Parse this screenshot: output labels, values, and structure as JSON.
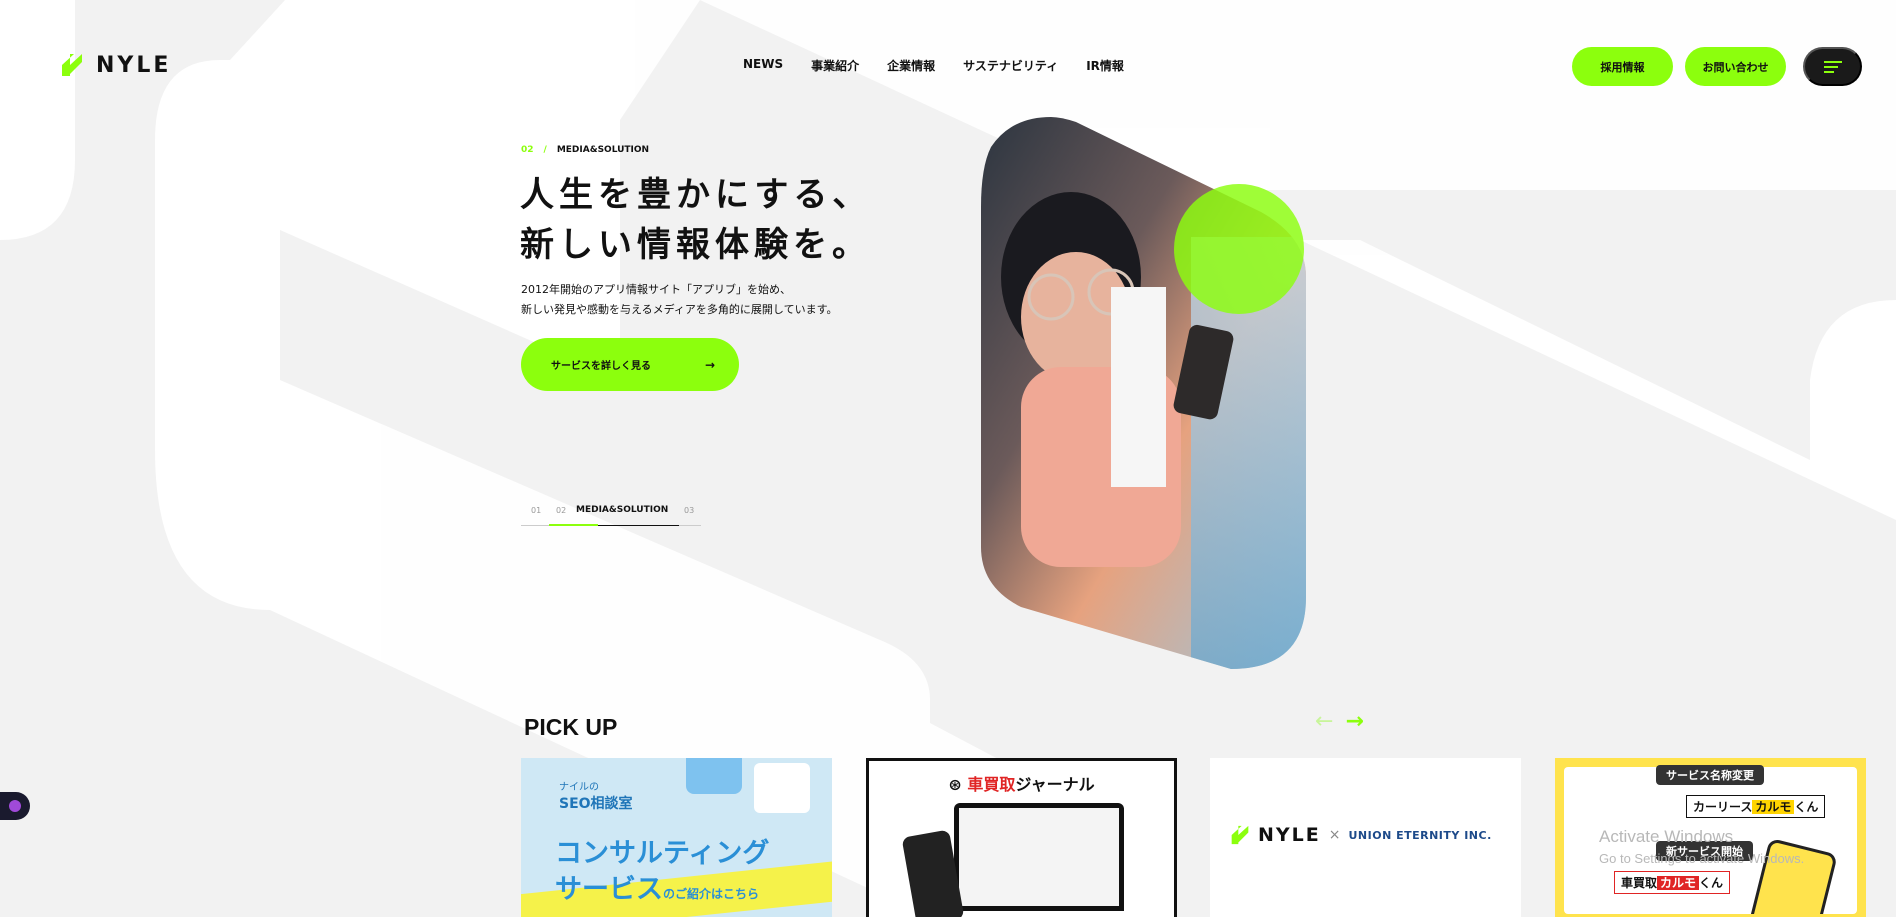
{
  "brand": {
    "logo_text": "NYLE",
    "accent": "#8cff0d"
  },
  "nav": {
    "items": [
      {
        "label": "NEWS"
      },
      {
        "label": "事業紹介"
      },
      {
        "label": "企業情報"
      },
      {
        "label": "サステナビリティ"
      },
      {
        "label": "IR情報"
      }
    ]
  },
  "header": {
    "recruit_label": "採用情報",
    "contact_label": "お問い合わせ",
    "menu_icon": "hamburger-icon"
  },
  "hero": {
    "crumb_num": "02",
    "crumb_slash": "/",
    "crumb_label": "MEDIA&SOLUTION",
    "title_line1": "人生を豊かにする、",
    "title_line2": "新しい情報体験を。",
    "desc_line1": "2012年開始のアプリ情報サイト「アプリブ」を始め、",
    "desc_line2": "新しい発見や感動を与えるメディアを多角的に展開しています。",
    "cta_label": "サービスを詳しく見る",
    "cta_arrow": "→",
    "slider": {
      "n1": "01",
      "n2": "02",
      "label": "MEDIA&SOLUTION",
      "n3": "03",
      "progress": 0.38
    }
  },
  "pickup": {
    "title": "PICK UP",
    "prev_arrow": "←",
    "next_arrow": "→",
    "cards": [
      {
        "brand_small": "ナイルの",
        "brand": "SEO相談室",
        "main1": "コンサルティング",
        "main2": "サービス",
        "sub": "のご紹介はこちら"
      },
      {
        "head_a": "車",
        "head_b": "買取",
        "head_c": "ジャーナル"
      },
      {
        "logo_a": "NYLE",
        "cross": "×",
        "logo_b": "UNION ETERNITY INC."
      },
      {
        "tag1": "サービス名称変更",
        "b1_a": "カーリース",
        "b1_b": "カルモ",
        "b1_c": "くん",
        "tag2": "新サービス開始",
        "b2_a": "車買取",
        "b2_b": "カルモ",
        "b2_c": "くん"
      }
    ]
  },
  "system": {
    "watermark_title": "Activate Windows",
    "watermark_sub": "Go to Settings to activate Windows."
  }
}
